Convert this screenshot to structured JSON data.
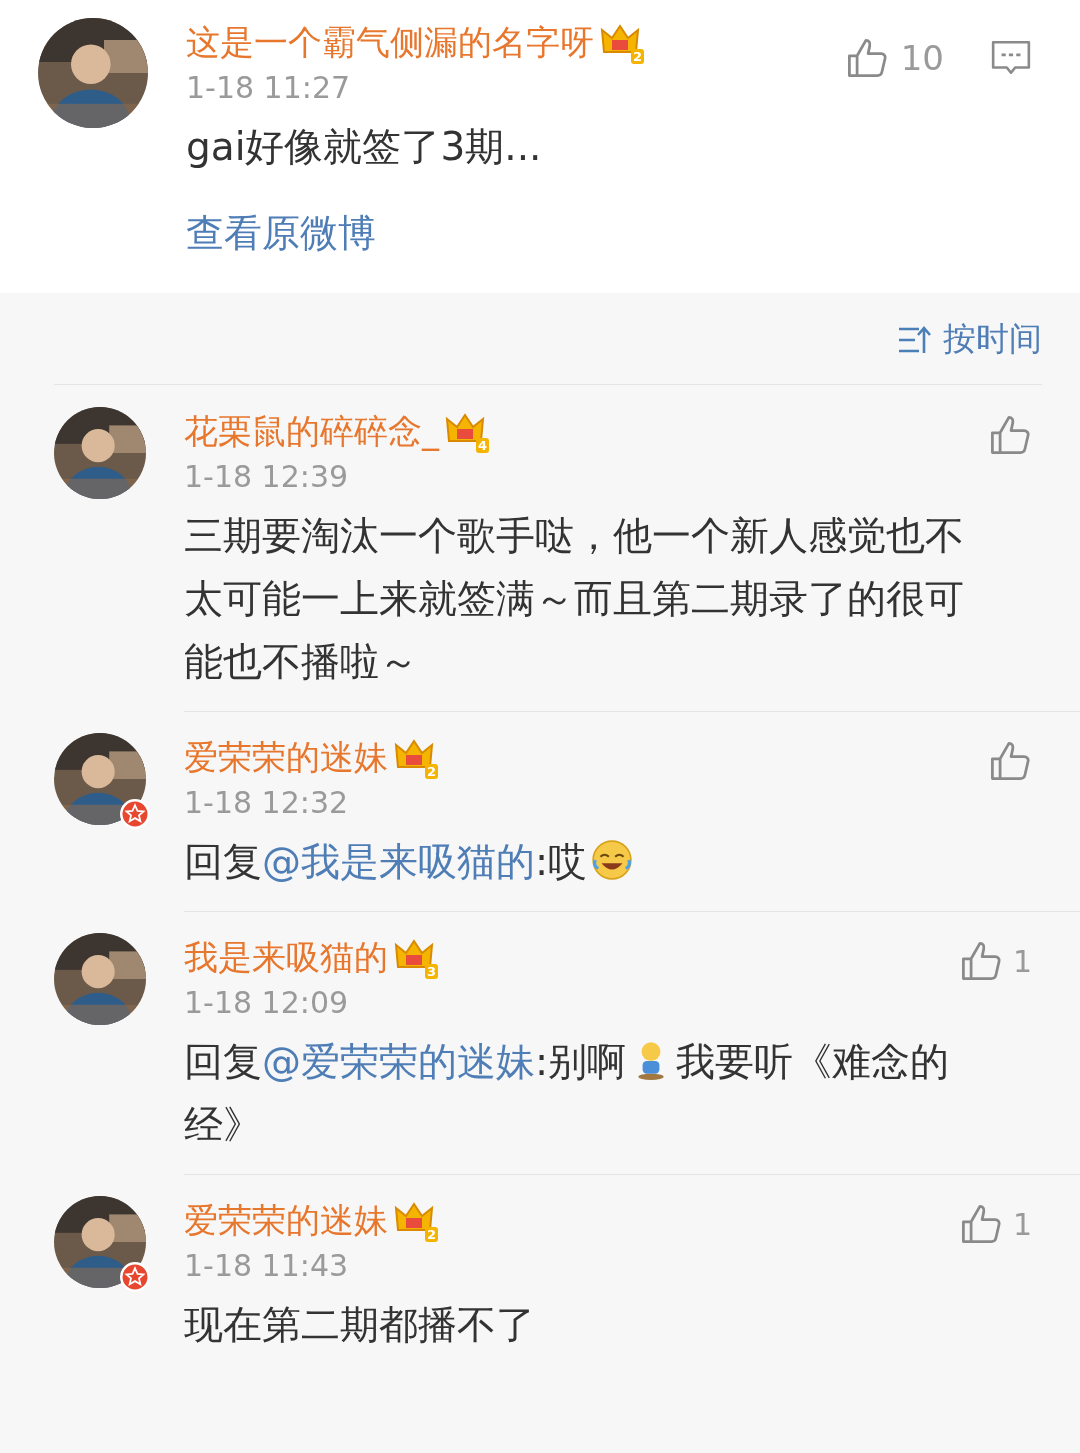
{
  "post": {
    "name": "这是一个霸气侧漏的名字呀",
    "level_badge": "2",
    "time": "1-18 11:27",
    "likes": "10",
    "text": "gai好像就签了3期...",
    "link": "查看原微博"
  },
  "sort": {
    "label": "按时间"
  },
  "comments": [
    {
      "name": "花栗鼠的碎碎念_",
      "level_badge": "4",
      "verified": false,
      "time": "1-18 12:39",
      "parts": [
        {
          "kind": "text",
          "text": "三期要淘汰一个歌手哒，他一个新人感觉也不太可能一上来就签满～而且第二期录了的很可能也不播啦～"
        }
      ]
    },
    {
      "name": "爱荣荣的迷妹",
      "level_badge": "2",
      "verified": true,
      "time": "1-18 12:32",
      "parts": [
        {
          "kind": "text",
          "text": "回复"
        },
        {
          "kind": "mention",
          "text": "@我是来吸猫的"
        },
        {
          "kind": "text",
          "text": ":哎"
        },
        {
          "kind": "laugh_emoji"
        }
      ]
    },
    {
      "name": "我是来吸猫的",
      "level_badge": "3",
      "verified": false,
      "time": "1-18 12:09",
      "likes": "1",
      "parts": [
        {
          "kind": "text",
          "text": "回复"
        },
        {
          "kind": "mention",
          "text": "@爱荣荣的迷妹"
        },
        {
          "kind": "text",
          "text": ":别啊"
        },
        {
          "kind": "figure_emoji"
        },
        {
          "kind": "text",
          "text": "我要听《难念的经》"
        }
      ]
    },
    {
      "name": "爱荣荣的迷妹",
      "level_badge": "2",
      "verified": true,
      "time": "1-18 11:43",
      "likes": "1",
      "parts": [
        {
          "kind": "text",
          "text": "现在第二期都播不了"
        }
      ]
    }
  ]
}
